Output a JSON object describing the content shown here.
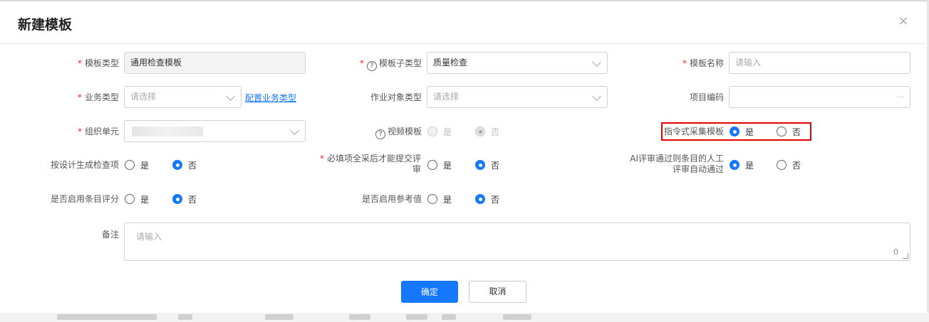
{
  "dialog": {
    "title": "新建模板",
    "close_icon": "×"
  },
  "row1": {
    "template_type": {
      "label": "模板类型",
      "value": "通用检查模板"
    },
    "template_subtype": {
      "label": "模板子类型",
      "value": "质量检查"
    },
    "template_name": {
      "label": "模板名称",
      "placeholder": "请输入"
    }
  },
  "row2": {
    "business_type": {
      "label": "业务类型",
      "placeholder": "请选择",
      "link": "配置业务类型"
    },
    "object_type": {
      "label": "作业对象类型",
      "placeholder": "请选择"
    },
    "project_code": {
      "label": "项目编码",
      "dots": "···"
    }
  },
  "row3": {
    "org_unit": {
      "label": "组织单元"
    },
    "video_template": {
      "label": "视频模板",
      "yes": "是",
      "no": "否"
    },
    "directive_template": {
      "label": "指令式采集模板",
      "yes": "是",
      "no": "否"
    }
  },
  "row4": {
    "gen_by_design": {
      "label": "按设计生成检查项",
      "yes": "是",
      "no": "否"
    },
    "required_collect": {
      "label": "必填项全采后才能提交评审",
      "yes": "是",
      "no": "否"
    },
    "ai_auto_pass": {
      "label": "AI评审通过则条目的人工评审自动通过",
      "yes": "是",
      "no": "否"
    }
  },
  "row5": {
    "item_scoring": {
      "label": "是否启用条目评分",
      "yes": "是",
      "no": "否"
    },
    "reference_value": {
      "label": "是否启用参考值",
      "yes": "是",
      "no": "否"
    }
  },
  "remark": {
    "label": "备注",
    "placeholder": "请输入",
    "count": "0"
  },
  "buttons": {
    "confirm": "确定",
    "cancel": "取消"
  },
  "colors": {
    "primary": "#1677ff",
    "required": "#f5222d",
    "highlight": "#e00000"
  }
}
